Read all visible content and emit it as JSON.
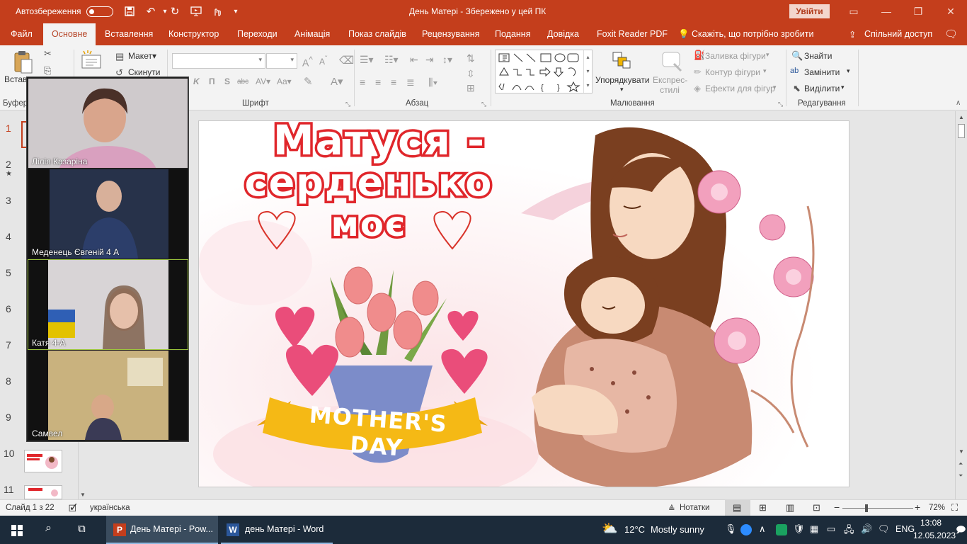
{
  "titlebar": {
    "autosave_label": "Автозбереження",
    "title": "День Матері  -  Збережено у цей ПК",
    "signin": "Увійти"
  },
  "tabs": {
    "file": "Файл",
    "home": "Основне",
    "insert": "Вставлення",
    "design": "Конструктор",
    "transitions": "Переходи",
    "animation": "Анімація",
    "slideshow": "Показ слайдів",
    "review": "Рецензування",
    "view": "Подання",
    "help": "Довідка",
    "foxit": "Foxit Reader PDF",
    "tellme": "Скажіть, що потрібно зробити",
    "share": "Спільний доступ"
  },
  "ribbon": {
    "paste": "Встав",
    "layout": "Макет",
    "reset": "Скинути",
    "clipboard_group": "Буфер",
    "font_group": "Шрифт",
    "paragraph_group": "Абзац",
    "drawing_group": "Малювання",
    "editing_group": "Редагування",
    "arrange": "Упорядкувати",
    "quick_styles": "Експрес-стилі",
    "shape_fill": "Заливка фігури",
    "shape_outline": "Контур фігури",
    "shape_effects": "Ефекти для фігур",
    "find": "Знайти",
    "replace": "Замінити",
    "select": "Виділити"
  },
  "thumbs": [
    "1",
    "2",
    "3",
    "4",
    "5",
    "6",
    "7",
    "8",
    "9",
    "10",
    "11"
  ],
  "video": {
    "p1": "Лілія Казаріна",
    "p2": "Меденець Євгеній 4 А",
    "p3": "Катя  4-А",
    "p4": "Самвел"
  },
  "slide": {
    "title_line1": "Матуся -",
    "title_line2": "серденько",
    "title_line3": "моє",
    "banner": "MOTHER'S DAY"
  },
  "status": {
    "slide_count": "Слайд 1 з 22",
    "language": "українська",
    "notes": "Нотатки",
    "zoom": "72%"
  },
  "taskbar": {
    "ppt_label": "День Матері - Pow...",
    "word_label": "день Матері - Word",
    "weather_temp": "12°C",
    "weather_desc": "Mostly sunny",
    "lang": "ENG",
    "time": "13:08",
    "date": "12.05.2023"
  },
  "colors": {
    "accent": "#c43e1c",
    "taskbar": "#1c2b3a",
    "title_red": "#e0262b"
  }
}
